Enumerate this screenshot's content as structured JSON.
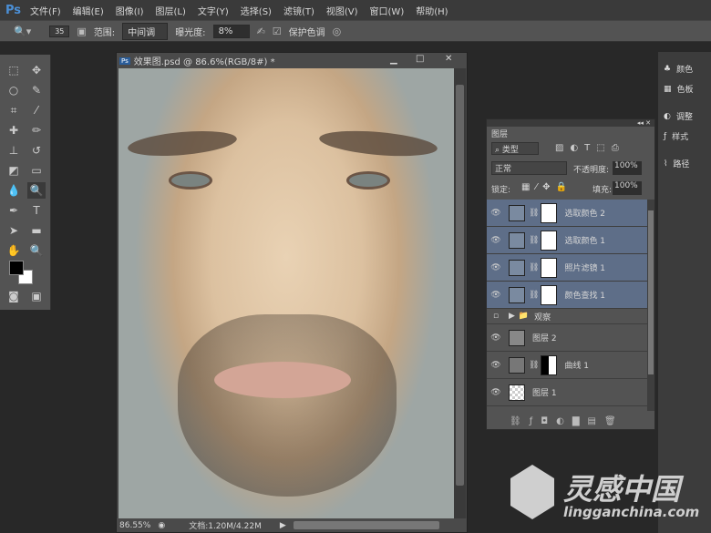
{
  "app": {
    "logo": "Ps"
  },
  "menu": [
    "文件(F)",
    "编辑(E)",
    "图像(I)",
    "图层(L)",
    "文字(Y)",
    "选择(S)",
    "滤镜(T)",
    "视图(V)",
    "窗口(W)",
    "帮助(H)"
  ],
  "options": {
    "brush_size": "35",
    "range_label": "范围:",
    "range_value": "中间调",
    "exposure_label": "曝光度:",
    "exposure_value": "8%",
    "protect_tones_label": "保护色调",
    "protect_tones_checked": true
  },
  "document": {
    "title": "效果图.psd @ 86.6%(RGB/8#) *",
    "zoom": "86.55%",
    "doc_info": "文档:1.20M/4.22M"
  },
  "layers_panel": {
    "tab": "图层",
    "filter_kind": "类型",
    "blend_mode": "正常",
    "opacity_label": "不透明度:",
    "opacity": "100%",
    "lock_label": "锁定:",
    "fill_label": "填充:",
    "fill": "100%",
    "layers": [
      {
        "name": "选取颜色 2",
        "type": "adjustment",
        "selected": true,
        "visible": true
      },
      {
        "name": "选取颜色 1",
        "type": "adjustment",
        "selected": true,
        "visible": true
      },
      {
        "name": "照片滤镜 1",
        "type": "adjustment",
        "selected": true,
        "visible": true
      },
      {
        "name": "颜色查找 1",
        "type": "adjustment",
        "selected": true,
        "visible": true
      },
      {
        "name": "观察",
        "type": "group",
        "selected": false,
        "visible": false
      },
      {
        "name": "图层 2",
        "type": "pixel",
        "selected": false,
        "visible": true
      },
      {
        "name": "曲线 1",
        "type": "curves",
        "selected": false,
        "visible": true
      },
      {
        "name": "图层 1",
        "type": "pixel",
        "selected": false,
        "visible": true
      }
    ]
  },
  "dock": [
    "颜色",
    "色板",
    "调整",
    "样式",
    "路径"
  ],
  "watermark": {
    "text": "灵感中国",
    "url": "lingganchina.com"
  }
}
